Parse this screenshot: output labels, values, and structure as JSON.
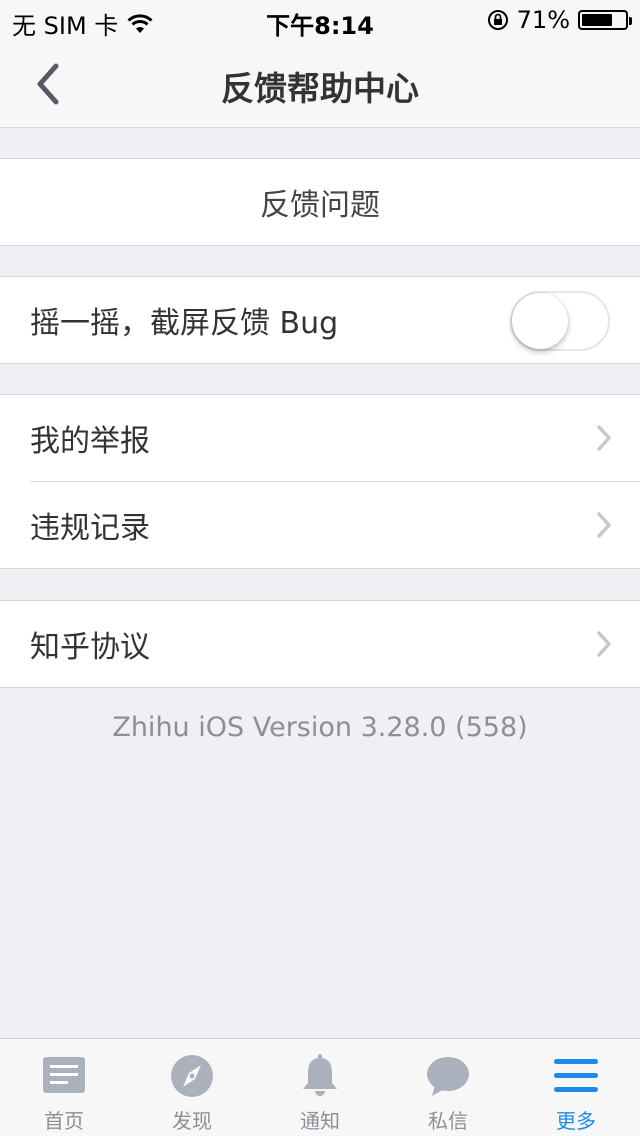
{
  "status_bar": {
    "carrier": "无 SIM 卡",
    "time": "下午8:14",
    "battery_percent": "71%",
    "battery_level": 0.71
  },
  "nav": {
    "title": "反馈帮助中心",
    "back_icon": "chevron-left-icon"
  },
  "feedback": {
    "label": "反馈问题"
  },
  "shake": {
    "label": "摇一摇，截屏反馈 Bug",
    "enabled": false
  },
  "group_reports": {
    "items": [
      {
        "label": "我的举报"
      },
      {
        "label": "违规记录"
      }
    ]
  },
  "group_agreement": {
    "items": [
      {
        "label": "知乎协议"
      }
    ]
  },
  "version_text": "Zhihu iOS Version 3.28.0 (558)",
  "tabbar": {
    "tabs": [
      {
        "label": "首页",
        "icon": "home-feed-icon"
      },
      {
        "label": "发现",
        "icon": "compass-icon"
      },
      {
        "label": "通知",
        "icon": "bell-icon"
      },
      {
        "label": "私信",
        "icon": "chat-bubble-icon"
      },
      {
        "label": "更多",
        "icon": "menu-icon",
        "active": true
      }
    ]
  },
  "colors": {
    "accent": "#1e8ae8",
    "inactive": "#aab0bc",
    "background": "#efeff4"
  }
}
